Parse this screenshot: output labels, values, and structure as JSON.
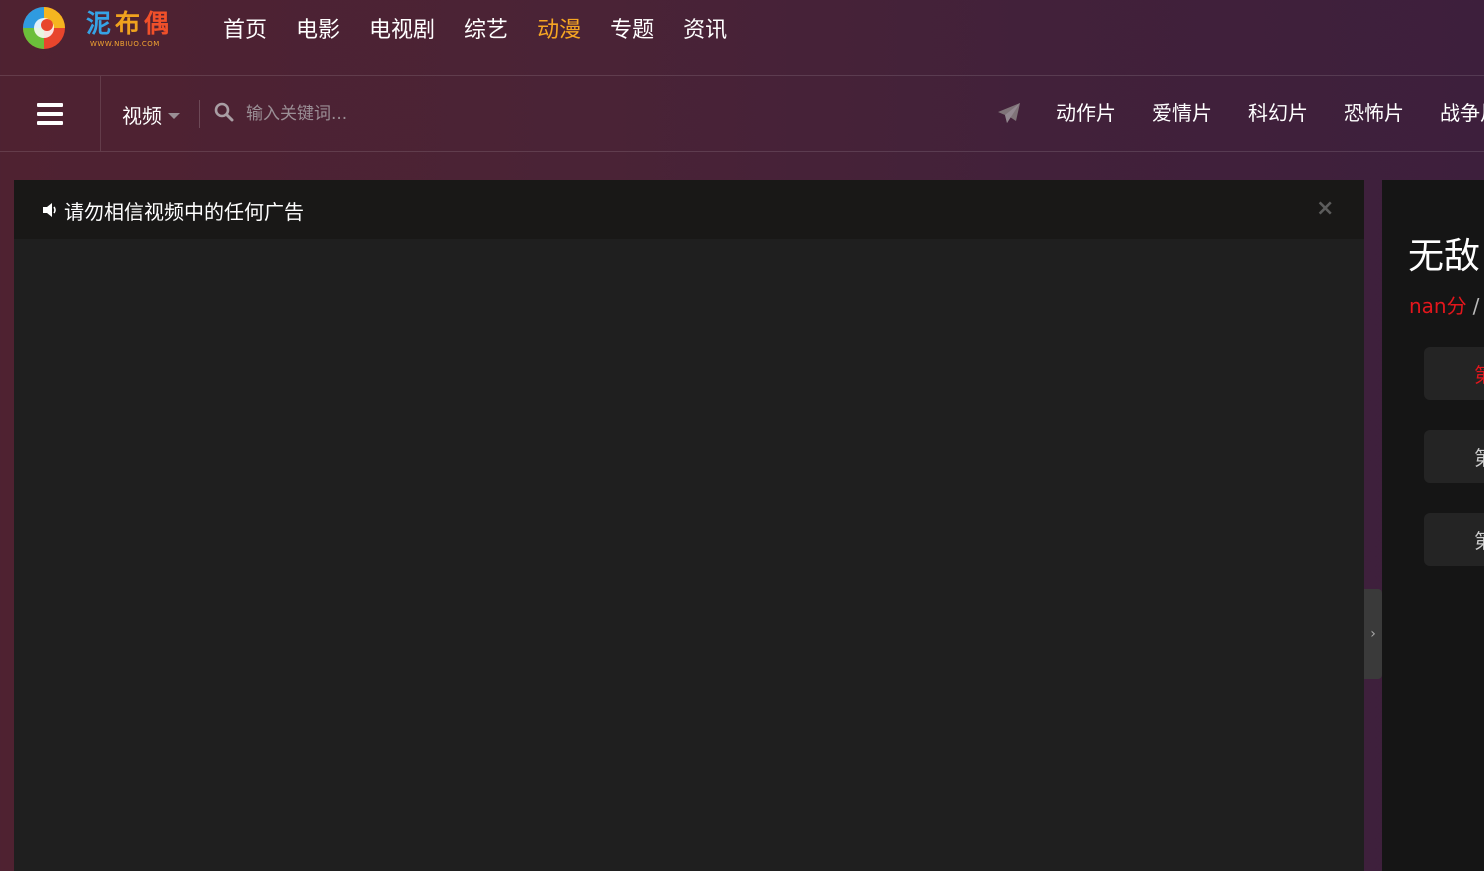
{
  "logo": {
    "chars": [
      "泥",
      "布",
      "偶"
    ],
    "sub": "WWW.NBIUO.COM",
    "colors": [
      "#36a3e6",
      "#f0a21e",
      "#f0502a"
    ]
  },
  "main_nav": [
    {
      "label": "首页",
      "active": false
    },
    {
      "label": "电影",
      "active": false
    },
    {
      "label": "电视剧",
      "active": false
    },
    {
      "label": "综艺",
      "active": false
    },
    {
      "label": "动漫",
      "active": true
    },
    {
      "label": "专题",
      "active": false
    },
    {
      "label": "资讯",
      "active": false
    }
  ],
  "search": {
    "scope": "视频",
    "placeholder": "输入关键词..."
  },
  "categories": [
    "动作片",
    "爱情片",
    "科幻片",
    "恐怖片",
    "战争片"
  ],
  "notice": {
    "text": "请勿相信视频中的任何广告",
    "close": "×"
  },
  "side": {
    "title": "无敌",
    "score": "nan分",
    "slash": "/",
    "episodes": [
      {
        "label": "第",
        "active": true
      },
      {
        "label": "第",
        "active": false
      },
      {
        "label": "第",
        "active": false
      }
    ]
  },
  "accent_color": "#f6a623",
  "score_color": "#e3161c"
}
